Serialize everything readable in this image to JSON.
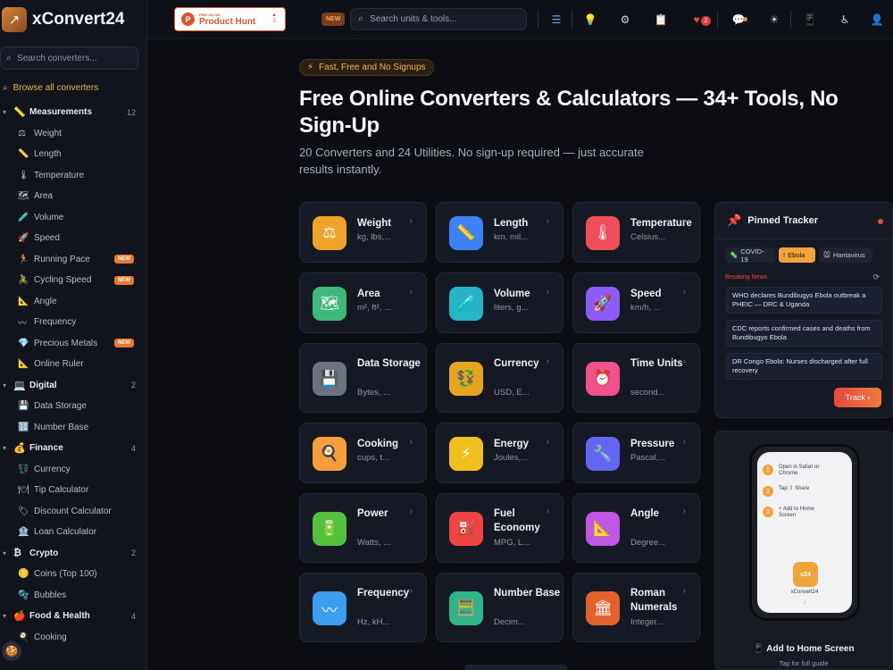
{
  "brand": {
    "name": "xConvert24",
    "logo": "↗"
  },
  "sidebar": {
    "search_placeholder": "Search converters...",
    "browse_all": "Browse all converters",
    "categories": [
      {
        "label": "Measurements",
        "icon": "📏",
        "count": "12",
        "items": [
          {
            "label": "Weight",
            "icon": "⚖"
          },
          {
            "label": "Length",
            "icon": "📏"
          },
          {
            "label": "Temperature",
            "icon": "🌡"
          },
          {
            "label": "Area",
            "icon": "🗺"
          },
          {
            "label": "Volume",
            "icon": "🧪"
          },
          {
            "label": "Speed",
            "icon": "🚀"
          },
          {
            "label": "Running Pace",
            "icon": "🏃",
            "badge": "NEW"
          },
          {
            "label": "Cycling Speed",
            "icon": "🚴",
            "badge": "NEW"
          },
          {
            "label": "Angle",
            "icon": "📐"
          },
          {
            "label": "Frequency",
            "icon": "〰"
          },
          {
            "label": "Precious Metals",
            "icon": "💎",
            "badge": "NEW"
          },
          {
            "label": "Online Ruler",
            "icon": "📐"
          }
        ]
      },
      {
        "label": "Digital",
        "icon": "💻",
        "count": "2",
        "items": [
          {
            "label": "Data Storage",
            "icon": "💾"
          },
          {
            "label": "Number Base",
            "icon": "🔢"
          }
        ]
      },
      {
        "label": "Finance",
        "icon": "💰",
        "count": "4",
        "items": [
          {
            "label": "Currency",
            "icon": "💱"
          },
          {
            "label": "Tip Calculator",
            "icon": "🍽"
          },
          {
            "label": "Discount Calculator",
            "icon": "🏷"
          },
          {
            "label": "Loan Calculator",
            "icon": "🏦"
          }
        ]
      },
      {
        "label": "Crypto",
        "icon": "₿",
        "count": "2",
        "items": [
          {
            "label": "Coins (Top 100)",
            "icon": "🪙"
          },
          {
            "label": "Bubbles",
            "icon": "🫧"
          }
        ]
      },
      {
        "label": "Food & Health",
        "icon": "🍎",
        "count": "4",
        "items": [
          {
            "label": "Cooking",
            "icon": "🍳"
          }
        ]
      }
    ]
  },
  "topbar": {
    "product_hunt": {
      "small": "FIND US ON",
      "big": "Product Hunt",
      "votes_arrow": "▲",
      "votes": "3"
    },
    "new_tag": "NEW",
    "search_placeholder": "Search units & tools...",
    "cart_count": "2"
  },
  "hero": {
    "pill": "Fast, Free and No Signups",
    "title": "Free Online Converters & Calculators — 34+ Tools, No Sign-Up",
    "subtitle": "20 Converters and 24 Utilities. No sign-up required — just accurate results instantly."
  },
  "cards": [
    {
      "title": "Weight",
      "desc": "kg, lbs,...",
      "icon": "⚖",
      "color": "#f0a22a"
    },
    {
      "title": "Length",
      "desc": "km, mil...",
      "icon": "📏",
      "color": "#3b82f6"
    },
    {
      "title": "Temperature",
      "desc": "Celsius...",
      "icon": "🌡",
      "color": "#ef4e5a"
    },
    {
      "title": "Area",
      "desc": "m², ft², ...",
      "icon": "🗺",
      "color": "#3fb97a"
    },
    {
      "title": "Volume",
      "desc": "liters, g...",
      "icon": "🧪",
      "color": "#25b5c9"
    },
    {
      "title": "Speed",
      "desc": "km/h, ...",
      "icon": "🚀",
      "color": "#8b5cf6"
    },
    {
      "title": "Data Storage",
      "desc": "Bytes, ...",
      "icon": "💾",
      "color": "#6b7280"
    },
    {
      "title": "Currency",
      "desc": "USD, E...",
      "icon": "💱",
      "color": "#e6a51f"
    },
    {
      "title": "Time Units",
      "desc": "second...",
      "icon": "⏰",
      "color": "#f0508b"
    },
    {
      "title": "Cooking",
      "desc": "cups, t...",
      "icon": "🍳",
      "color": "#f59e3a"
    },
    {
      "title": "Energy",
      "desc": "Joules,...",
      "icon": "⚡",
      "color": "#f0c01e"
    },
    {
      "title": "Pressure",
      "desc": "Pascal,...",
      "icon": "🔧",
      "color": "#6366f1"
    },
    {
      "title": "Power",
      "desc": "Watts, ...",
      "icon": "🔋",
      "color": "#53c13b"
    },
    {
      "title": "Fuel Economy",
      "desc": "MPG, L...",
      "icon": "⛽",
      "color": "#ef4444"
    },
    {
      "title": "Angle",
      "desc": "Degree...",
      "icon": "📐",
      "color": "#c155e6"
    },
    {
      "title": "Frequency",
      "desc": "Hz, kH...",
      "icon": "〰",
      "color": "#3b9cf0"
    },
    {
      "title": "Number Base",
      "desc": "Decim...",
      "icon": "🧮",
      "color": "#2fb388"
    },
    {
      "title": "Roman Numerals",
      "desc": "Integer...",
      "icon": "🏛",
      "color": "#e2622d"
    }
  ],
  "tracker": {
    "title": "Pinned Tracker",
    "tabs": [
      "COVID-19",
      "Ebola",
      "Hantavirus"
    ],
    "tab_icons": [
      "🦠",
      "!",
      "🐭"
    ],
    "active_tab": "Ebola",
    "breaking": "Breaking News",
    "news": [
      "WHO declares Bundibugyo Ebola outbreak a PHEIC — DRC & Uganda",
      "CDC reports confirmed cases and deaths from Bundibugyo Ebola",
      "DR Congo Ebola: Nurses discharged after full recovery"
    ],
    "track_label": "Track",
    "track_arrow": "›"
  },
  "install": {
    "steps": [
      {
        "n": "1",
        "text": "Open in Safari or Chrome"
      },
      {
        "n": "2",
        "text": "Tap ⇪ Share"
      },
      {
        "n": "3",
        "text": "+ Add to Home Screen"
      }
    ],
    "app_icon_text": "x24",
    "app_name": "xConvert24",
    "title": "📱 Add to Home Screen",
    "subtitle": "Tap for full guide"
  }
}
